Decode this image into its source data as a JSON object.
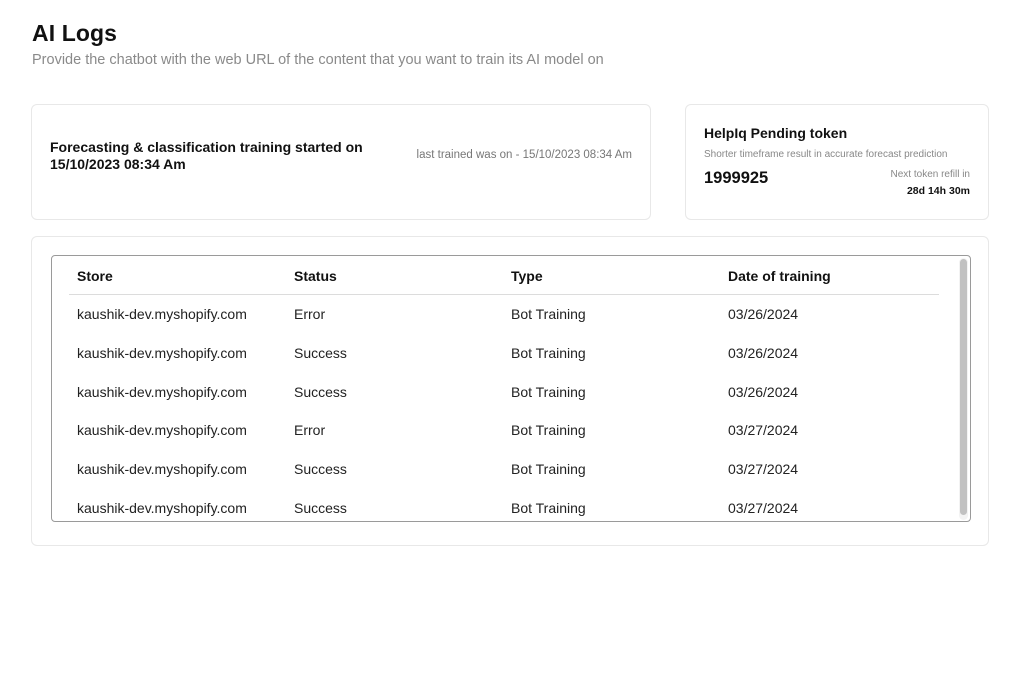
{
  "header": {
    "title": "AI Logs",
    "subtitle": "Provide the chatbot with the web URL of the content that you want to train its AI model on"
  },
  "training_card": {
    "title": "Forecasting & classification training started on 15/10/2023 08:34 Am",
    "last_trained": "last trained was on - 15/10/2023 08:34 Am"
  },
  "token_card": {
    "title": "HelpIq Pending token",
    "description": "Shorter timeframe result in accurate forecast prediction",
    "count": "1999925",
    "refill_label": "Next token refill in",
    "refill_value": "28d 14h 30m"
  },
  "table": {
    "headers": [
      "Store",
      "Status",
      "Type",
      "Date of training"
    ],
    "rows": [
      [
        "kaushik-dev.myshopify.com",
        "Error",
        "Bot Training",
        "03/26/2024"
      ],
      [
        "kaushik-dev.myshopify.com",
        "Success",
        "Bot Training",
        "03/26/2024"
      ],
      [
        "kaushik-dev.myshopify.com",
        "Success",
        "Bot Training",
        "03/26/2024"
      ],
      [
        "kaushik-dev.myshopify.com",
        "Error",
        "Bot Training",
        "03/27/2024"
      ],
      [
        "kaushik-dev.myshopify.com",
        "Success",
        "Bot Training",
        "03/27/2024"
      ],
      [
        "kaushik-dev.myshopify.com",
        "Success",
        "Bot Training",
        "03/27/2024"
      ]
    ]
  }
}
